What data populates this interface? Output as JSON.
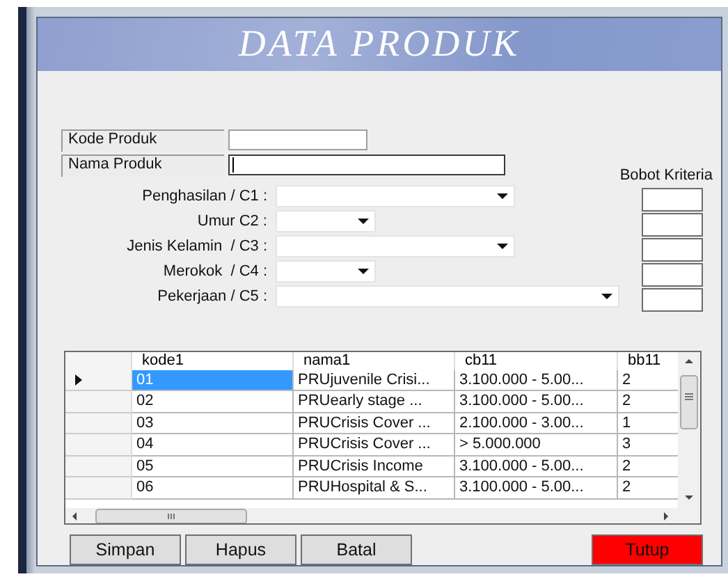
{
  "window": {
    "title": "DATA PRODUK"
  },
  "fields": [
    {
      "label": "Kode Produk",
      "focused": false
    },
    {
      "label": "Nama Produk",
      "focused": true
    }
  ],
  "criteria_heading": "Bobot Kriteria",
  "criteria": [
    {
      "label": "Penghasilan / C1 :"
    },
    {
      "label": "Umur C2 :"
    },
    {
      "label": "Jenis Kelamin  / C3 :"
    },
    {
      "label": "Merokok  / C4 :"
    },
    {
      "label": "Pekerjaan / C5 :"
    }
  ],
  "table": {
    "columns": [
      "kode1",
      "nama1",
      "cb11",
      "bb11"
    ],
    "rows": [
      {
        "selected": true,
        "cells": [
          "01",
          "PRUjuvenile Crisi...",
          "3.100.000 - 5.00...",
          "2"
        ]
      },
      {
        "selected": false,
        "cells": [
          "02",
          "PRUearly stage ...",
          "3.100.000 - 5.00...",
          "2"
        ]
      },
      {
        "selected": false,
        "cells": [
          "03",
          "PRUCrisis Cover ...",
          "2.100.000 - 3.00...",
          "1"
        ]
      },
      {
        "selected": false,
        "cells": [
          "04",
          "PRUCrisis Cover ...",
          "> 5.000.000",
          "3"
        ]
      },
      {
        "selected": false,
        "cells": [
          "05",
          "PRUCrisis Income",
          "3.100.000 - 5.00...",
          "2"
        ]
      },
      {
        "selected": false,
        "cells": [
          "06",
          "PRUHospital & S...",
          "3.100.000 - 5.00...",
          "2"
        ]
      }
    ]
  },
  "buttons": [
    {
      "label": "Simpan",
      "kind": "normal"
    },
    {
      "label": "Hapus",
      "kind": "normal"
    },
    {
      "label": "Batal",
      "kind": "normal"
    },
    {
      "label": "Tutup",
      "kind": "danger"
    }
  ]
}
